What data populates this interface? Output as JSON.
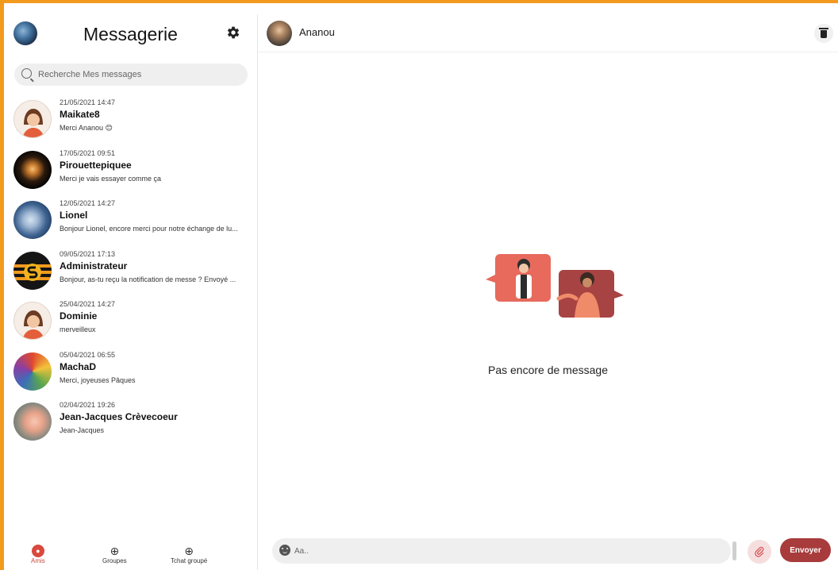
{
  "sidebar": {
    "title": "Messagerie",
    "search_placeholder": "Recherche Mes messages",
    "conversations": [
      {
        "date": "21/05/2021 14:47",
        "name": "Maikate8",
        "preview": "Merci Ananou 😊"
      },
      {
        "date": "17/05/2021 09:51",
        "name": "Pirouettepiquee",
        "preview": "Merci je vais essayer comme ça"
      },
      {
        "date": "12/05/2021 14:27",
        "name": "Lionel",
        "preview": "Bonjour Lionel, encore merci pour notre échange de lu..."
      },
      {
        "date": "09/05/2021 17:13",
        "name": "Administrateur",
        "preview": "Bonjour, as-tu reçu la notification de messe ? Envoyé ..."
      },
      {
        "date": "25/04/2021 14:27",
        "name": "Dominie",
        "preview": "merveilleux"
      },
      {
        "date": "05/04/2021 06:55",
        "name": "MachaD",
        "preview": "Merci, joyeuses Pâques"
      },
      {
        "date": "02/04/2021 19:26",
        "name": "Jean-Jacques Crèvecoeur",
        "preview": "Jean-Jacques"
      }
    ],
    "nav": [
      {
        "label": "Amis"
      },
      {
        "label": "Groupes"
      },
      {
        "label": "Tchat groupé"
      }
    ]
  },
  "chat": {
    "contact_name": "Ananou",
    "empty_text": "Pas encore de message",
    "composer_placeholder": "Aa..",
    "send_label": "Envoyer"
  },
  "colors": {
    "frame": "#f29a1e",
    "accent": "#a83b3b",
    "active_nav": "#d9493d"
  }
}
